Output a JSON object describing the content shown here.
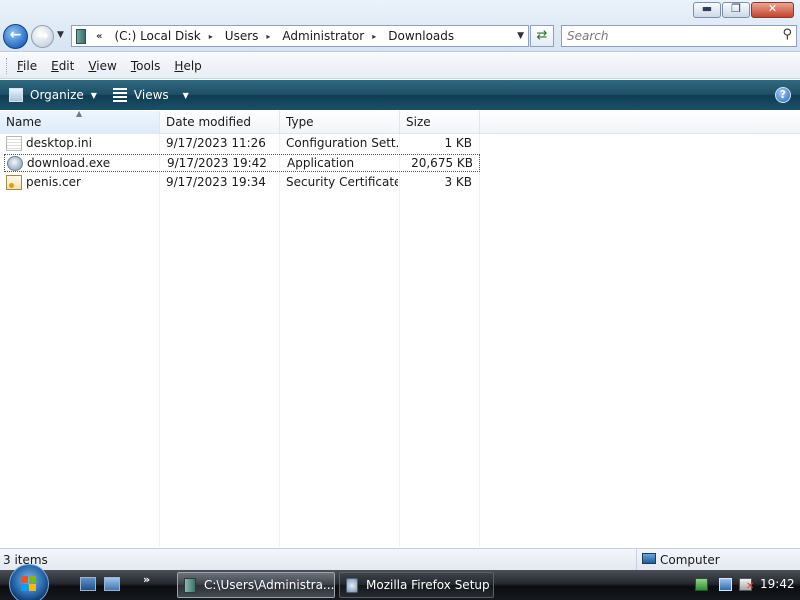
{
  "window": {
    "controls": {
      "minimize": "▬",
      "maximize": "❐",
      "close": "✕"
    }
  },
  "address_bar": {
    "overflow": "«",
    "crumbs": [
      "(C:) Local Disk",
      "Users",
      "Administrator",
      "Downloads"
    ],
    "separator": "▸"
  },
  "search": {
    "placeholder": "Search"
  },
  "menu": {
    "items": [
      {
        "label": "File",
        "accel": "F",
        "rest": "ile"
      },
      {
        "label": "Edit",
        "accel": "E",
        "rest": "dit"
      },
      {
        "label": "View",
        "accel": "V",
        "rest": "iew"
      },
      {
        "label": "Tools",
        "accel": "T",
        "rest": "ools"
      },
      {
        "label": "Help",
        "accel": "H",
        "rest": "elp"
      }
    ]
  },
  "command_bar": {
    "organize": "Organize",
    "views": "Views",
    "help": "?"
  },
  "columns": [
    "Name",
    "Date modified",
    "Type",
    "Size"
  ],
  "files": [
    {
      "name": "desktop.ini",
      "date": "9/17/2023 11:26",
      "type": "Configuration Sett...",
      "size": "1 KB",
      "icon": "ini-file-icon"
    },
    {
      "name": "download.exe",
      "date": "9/17/2023 19:42",
      "type": "Application",
      "size": "20,675 KB",
      "icon": "exe-file-icon",
      "selected": true
    },
    {
      "name": "penis.cer",
      "date": "9/17/2023 19:34",
      "type": "Security Certificate",
      "size": "3 KB",
      "icon": "certificate-file-icon"
    }
  ],
  "status": {
    "count": "3 items",
    "zone": "Computer"
  },
  "taskbar": {
    "tasks": [
      {
        "label": "C:\\Users\\Administra...",
        "active": true
      },
      {
        "label": "Mozilla Firefox Setup",
        "active": false
      }
    ],
    "clock": "19:42"
  }
}
